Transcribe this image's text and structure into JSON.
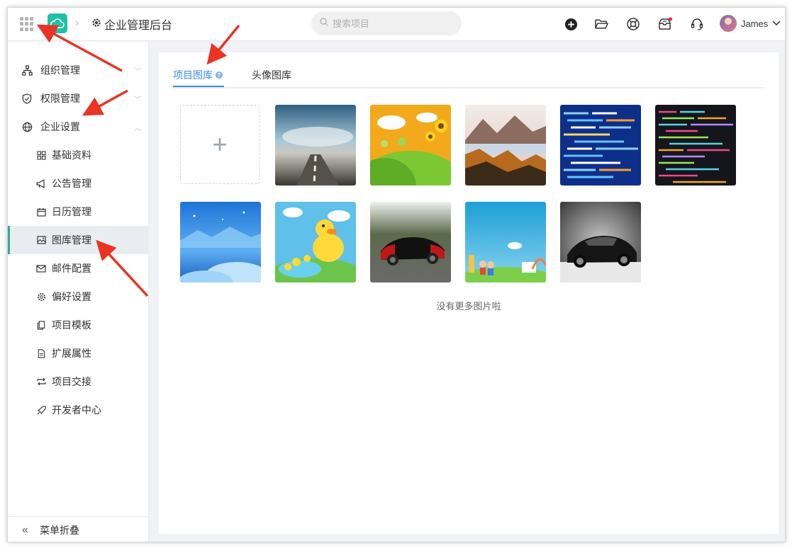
{
  "header": {
    "title": "企业管理后台",
    "search_placeholder": "搜索项目",
    "user_name": "James",
    "notification_color": "#f5222d"
  },
  "sidebar": {
    "menus": [
      {
        "label": "组织管理",
        "icon": "org-chart-icon",
        "expanded": false
      },
      {
        "label": "权限管理",
        "icon": "shield-icon",
        "expanded": false
      },
      {
        "label": "企业设置",
        "icon": "globe-icon",
        "expanded": true
      }
    ],
    "sub_items": [
      {
        "label": "基础资料",
        "icon": "grid-icon"
      },
      {
        "label": "公告管理",
        "icon": "megaphone-icon"
      },
      {
        "label": "日历管理",
        "icon": "calendar-icon"
      },
      {
        "label": "图库管理",
        "icon": "image-icon",
        "active": true
      },
      {
        "label": "邮件配置",
        "icon": "mail-icon"
      },
      {
        "label": "偏好设置",
        "icon": "gear-icon"
      },
      {
        "label": "项目模板",
        "icon": "copy-icon"
      },
      {
        "label": "扩展属性",
        "icon": "document-icon"
      },
      {
        "label": "项目交接",
        "icon": "swap-icon"
      },
      {
        "label": "开发者中心",
        "icon": "rocket-icon"
      }
    ],
    "collapse_label": "菜单折叠"
  },
  "content": {
    "tabs": [
      {
        "label": "项目图库",
        "active": true
      },
      {
        "label": "头像图库",
        "active": false
      }
    ],
    "help_mark": "?",
    "images": [
      {
        "name": "road-sky-image"
      },
      {
        "name": "sunflower-cartoon-image"
      },
      {
        "name": "mountain-lake-image"
      },
      {
        "name": "code-blue-image"
      },
      {
        "name": "code-dark-image"
      },
      {
        "name": "blue-winter-image"
      },
      {
        "name": "duck-cartoon-image"
      },
      {
        "name": "red-car-image"
      },
      {
        "name": "kids-cartoon-image"
      },
      {
        "name": "black-car-image"
      }
    ],
    "footer_text": "没有更多图片啦"
  },
  "colors": {
    "accent": "#3a8ee6",
    "brand": "#20c0a8",
    "active_bar": "#2aae9a",
    "annotation": "#ea3323"
  }
}
